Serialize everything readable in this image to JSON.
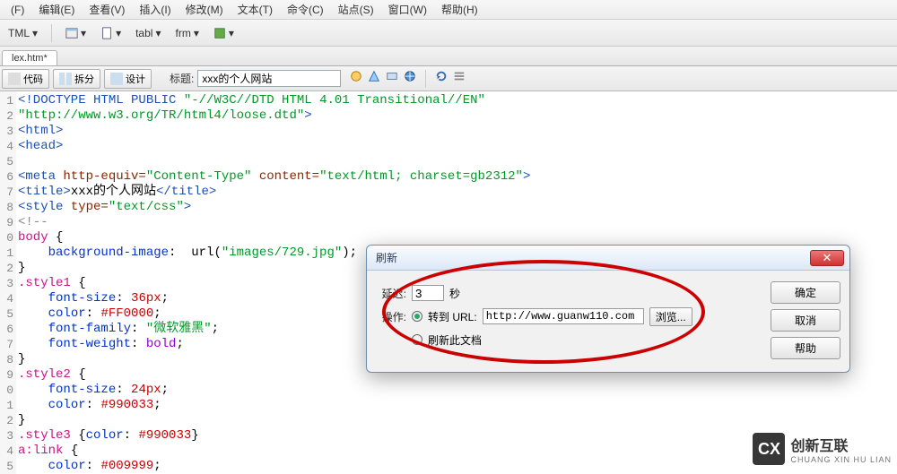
{
  "menu": {
    "items": [
      "(F)",
      "编辑(E)",
      "查看(V)",
      "插入(I)",
      "修改(M)",
      "文本(T)",
      "命令(C)",
      "站点(S)",
      "窗口(W)",
      "帮助(H)"
    ]
  },
  "toolbar": {
    "left": "TML",
    "tabl": "tabl",
    "frm": "frm"
  },
  "tab": {
    "label": "lex.htm*"
  },
  "viewbar": {
    "code": "代码",
    "split": "拆分",
    "design": "设计",
    "title_label": "标题:",
    "title_value": "xxx的个人网站"
  },
  "code": {
    "lines": [
      {
        "n": "1",
        "html": "<span class='c-tag'>&lt;!DOCTYPE HTML PUBLIC </span><span class='c-str'>\"-//W3C//DTD HTML 4.01 Transitional//EN\"</span>"
      },
      {
        "n": "2",
        "html": "<span class='c-str'>\"http://www.w3.org/TR/html4/loose.dtd\"</span><span class='c-tag'>&gt;</span>"
      },
      {
        "n": "3",
        "html": "<span class='c-tag'>&lt;html&gt;</span>"
      },
      {
        "n": "4",
        "html": "<span class='c-tag'>&lt;head&gt;</span>"
      },
      {
        "n": "5",
        "html": " "
      },
      {
        "n": "6",
        "html": "<span class='c-tag'>&lt;meta </span><span class='c-attr'>http-equiv=</span><span class='c-str'>\"Content-Type\"</span> <span class='c-attr'>content=</span><span class='c-str'>\"text/html; charset=gb2312\"</span><span class='c-tag'>&gt;</span>"
      },
      {
        "n": "7",
        "html": "<span class='c-tag'>&lt;title&gt;</span>xxx的个人网站<span class='c-tag'>&lt;/title&gt;</span>"
      },
      {
        "n": "8",
        "html": "<span class='c-tag'>&lt;style </span><span class='c-attr'>type=</span><span class='c-str'>\"text/css\"</span><span class='c-tag'>&gt;</span>"
      },
      {
        "n": "9",
        "html": "<span class='c-comm'>&lt;!--</span>"
      },
      {
        "n": "0",
        "html": "<span class='c-sel'>body</span> {"
      },
      {
        "n": "1",
        "html": "    <span class='c-prop'>background-image</span>:  url(<span class='c-str'>\"images/729.jpg\"</span>);"
      },
      {
        "n": "2",
        "html": "}"
      },
      {
        "n": "3",
        "html": "<span class='c-sel'>.style1</span> {"
      },
      {
        "n": "4",
        "html": "    <span class='c-prop'>font-size</span>: <span class='c-num'>36px</span>;"
      },
      {
        "n": "5",
        "html": "    <span class='c-prop'>color</span>: <span class='c-num'>#FF0000</span>;"
      },
      {
        "n": "6",
        "html": "    <span class='c-prop'>font-family</span>: <span class='c-str'>\"微软雅黑\"</span>;"
      },
      {
        "n": "7",
        "html": "    <span class='c-prop'>font-weight</span>: <span class='c-kw'>bold</span>;"
      },
      {
        "n": "8",
        "html": "}"
      },
      {
        "n": "9",
        "html": "<span class='c-sel'>.style2</span> {"
      },
      {
        "n": "0",
        "html": "    <span class='c-prop'>font-size</span>: <span class='c-num'>24px</span>;"
      },
      {
        "n": "1",
        "html": "    <span class='c-prop'>color</span>: <span class='c-num'>#990033</span>;"
      },
      {
        "n": "2",
        "html": "}"
      },
      {
        "n": "3",
        "html": "<span class='c-sel'>.style3</span> {<span class='c-prop'>color</span>: <span class='c-num'>#990033</span>}"
      },
      {
        "n": "4",
        "html": "<span class='c-sel'>a:link</span> {"
      },
      {
        "n": "5",
        "html": "    <span class='c-prop'>color</span>: <span class='c-num'>#009999</span>;"
      }
    ]
  },
  "dialog": {
    "title": "刷新",
    "delay_label": "延迟:",
    "delay_value": "3",
    "delay_unit": "秒",
    "op_label": "操作:",
    "goto_label": "转到 URL:",
    "goto_url": "http://www.guanw110.com",
    "browse": "浏览...",
    "refresh_label": "刷新此文档",
    "ok": "确定",
    "cancel": "取消",
    "help": "帮助"
  },
  "watermark": {
    "brand": "创新互联",
    "sub": "CHUANG XIN HU LIAN",
    "icon": "CX"
  }
}
